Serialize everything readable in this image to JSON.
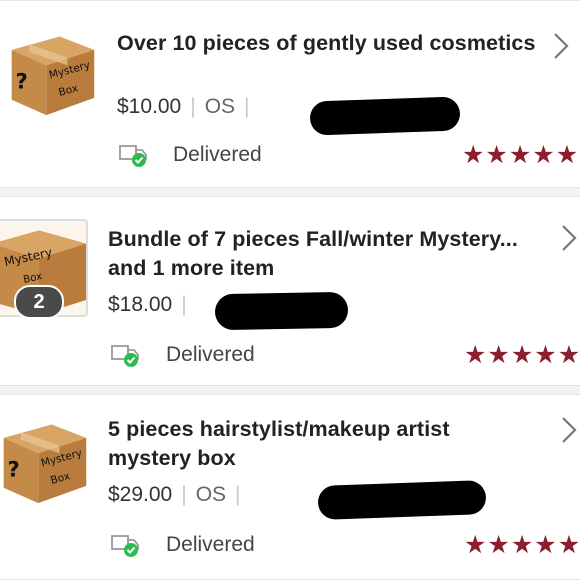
{
  "orders": [
    {
      "thumbnail": {
        "label_line1": "Mystery",
        "label_line2": "Box"
      },
      "title": "Over 10 pieces of gently used cosmetics",
      "price": "$10.00",
      "size": "OS",
      "status": "Delivered",
      "rating": 5
    },
    {
      "thumbnail": {
        "label_line1": "Mystery",
        "label_line2": "Box"
      },
      "item_count": "2",
      "title": "Bundle of 7 pieces Fall/winter Mystery... and 1 more item",
      "price": "$18.00",
      "size": "",
      "status": "Delivered",
      "rating": 5
    },
    {
      "thumbnail": {
        "label_line1": "Mystery",
        "label_line2": "Box"
      },
      "title": "5 pieces hairstylist/makeup artist mystery box",
      "price": "$29.00",
      "size": "OS",
      "status": "Delivered",
      "rating": 5
    }
  ],
  "icons": {
    "chevron": "chevron-right-icon",
    "delivered": "delivered-truck-icon",
    "star": "star-icon"
  },
  "colors": {
    "star": "#8b1e2f",
    "delivered_check": "#2dbb4f",
    "box": "#c8904e"
  }
}
